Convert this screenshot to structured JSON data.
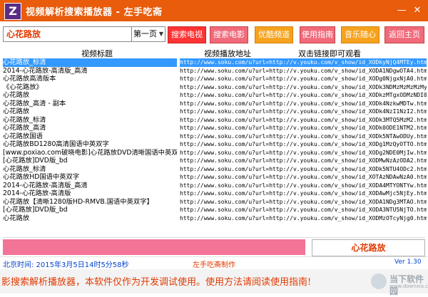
{
  "window": {
    "icon_letter": "Z",
    "title": "视频解析搜索播放器 - 左手吃斋",
    "minimize": "—",
    "close": "✕"
  },
  "toolbar": {
    "search_value": "心花路放",
    "page_value": "第一页",
    "buttons": [
      "搜索电视剧",
      "搜索电影",
      "优酷频道",
      "使用指南",
      "音乐随心听",
      "返回主页"
    ]
  },
  "table": {
    "headers": [
      "视频标题",
      "视频播放地址",
      "双击链接即可观看"
    ],
    "rows": [
      {
        "title": "心花路放_标清",
        "url": "http://www.soku.com/u?url=http://v.youku.com/v_show/id_XODkyNjQ4MTEy.html",
        "selected": true
      },
      {
        "title": "2014-心花路放-高清版_高清",
        "url": "http://www.soku.com/u?url=http://v.youku.com/v_show/id_XODA1NDgwOTA4.html",
        "selected": false
      },
      {
        "title": "心花路放高清版本",
        "url": "http://www.soku.com/u?url=http://v.youku.com/v_show/id_XODg0NjgxNjA0.html",
        "selected": false
      },
      {
        "title": "《心花路放》",
        "url": "http://www.soku.com/u?url=http://v.youku.com/v_show/id_XODk3NDMzMzMzMzMy.html",
        "selected": false
      },
      {
        "title": "心花路放",
        "url": "http://www.soku.com/u?url=http://v.youku.com/v_show/id_XODkzMTgxODMzNDI0.html",
        "selected": false
      },
      {
        "title": "心花路放_高清 - 副本",
        "url": "http://www.soku.com/u?url=http://v.youku.com/v_show/id_XODk4NzkwMDTw.html",
        "selected": false
      },
      {
        "title": "心花路放",
        "url": "http://www.soku.com/u?url=http://v.youku.com/v_show/id_XODk4NzI1NzI2.html",
        "selected": false
      },
      {
        "title": "心花路放_标清",
        "url": "http://www.soku.com/u?url=http://v.youku.com/v_show/id_XODk3MTQ5MzM2.html",
        "selected": false
      },
      {
        "title": "心花路放_高清",
        "url": "http://www.soku.com/u?url=http://v.youku.com/v_show/id_XODk0ODE1NTM2.html",
        "selected": false
      },
      {
        "title": "心花路放国语",
        "url": "http://www.soku.com/u?url=http://v.youku.com/v_show/id_XODk5NTAwODUy.html",
        "selected": false
      },
      {
        "title": "心花路放BD1280高清国语中英双字",
        "url": "http://www.soku.com/u?url=http://v.youku.com/v_show/id_XODg1MzQyOTTO.html",
        "selected": false
      },
      {
        "title": "[www.poxiao.com破晓电影]心花路放DVD清晰国语中英双字",
        "url": "http://www.soku.com/u?url=http://v.youku.com/v_show/id_XODg2NDE0MjIw.html",
        "selected": false
      },
      {
        "title": "[心花路放]DVD版_bd",
        "url": "http://www.soku.com/u?url=http://v.youku.com/v_show/id_XODMwNzAzODA2.html",
        "selected": false
      },
      {
        "title": "心花路放_标清",
        "url": "http://www.soku.com/u?url=http://v.youku.com/v_show/id_XODk5NTU4ODc2.html",
        "selected": false
      },
      {
        "title": "心花路放HD国语中英双字",
        "url": "http://www.soku.com/u?url=http://v.youku.com/v_show/id_XOTAzNDAwNzA0.html",
        "selected": false
      },
      {
        "title": "2014-心花路放-高清版_高清",
        "url": "http://www.soku.com/u?url=http://v.youku.com/v_show/id_XODA4MTYONTYw.html",
        "selected": false
      },
      {
        "title": "2014-心花路放-高清版",
        "url": "http://www.soku.com/u?url=http://v.youku.com/v_show/id_XODAwMjc5NjEy.html",
        "selected": false
      },
      {
        "title": "心花路放【清晰1280版HD-RMVB.国语中英双字】",
        "url": "http://www.soku.com/u?url=http://v.youku.com/v_show/id_XODA1NDg3MTAO.html",
        "selected": false
      },
      {
        "title": "[心花路放]DVD版_bd",
        "url": "http://www.soku.com/u?url=http://v.youku.com/v_show/id_XODA3NTU5NjTO.html",
        "selected": false
      },
      {
        "title": "心花路放",
        "url": "http://www.soku.com/u?url=http://v.youku.com/v_show/id_XODMzOTcyNjg0.html",
        "selected": false
      }
    ]
  },
  "selected_title": "心花路放",
  "status": {
    "time": "北京时间: 2015年3月5日14时5分58秒",
    "author": "左手吃斋制作",
    "version": "Ver 1.30"
  },
  "footer": {
    "marquee": "影搜索解析播放器，本软件仅作为开发调试使用。使用方法请阅读使用指南!"
  },
  "watermark": {
    "text": "当下软件园",
    "sub": "www.downxia.com"
  }
}
